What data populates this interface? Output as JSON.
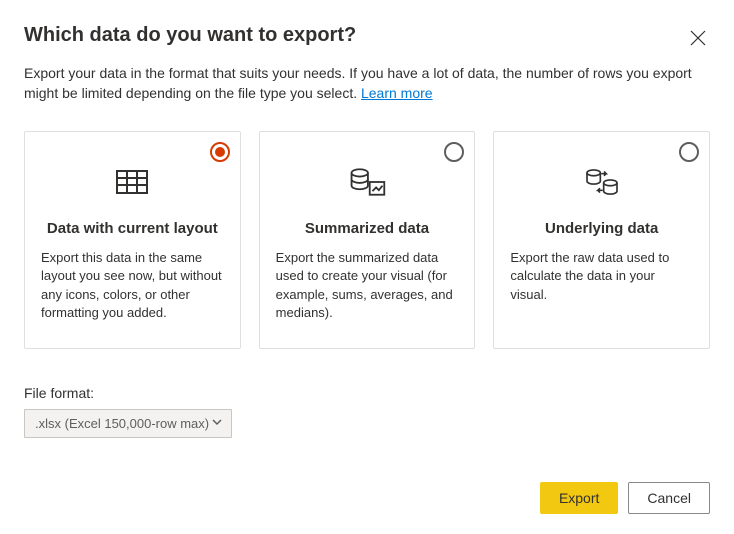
{
  "header": {
    "title": "Which data do you want to export?"
  },
  "description": {
    "text": "Export your data in the format that suits your needs. If you have a lot of data, the number of rows you export might be limited depending on the file type you select.  ",
    "learn_more": "Learn more"
  },
  "cards": [
    {
      "title": "Data with current layout",
      "desc": "Export this data in the same layout you see now, but without any icons, colors, or other formatting you added.",
      "selected": true
    },
    {
      "title": "Summarized data",
      "desc": "Export the summarized data used to create your visual (for example, sums, averages, and medians).",
      "selected": false
    },
    {
      "title": "Underlying data",
      "desc": "Export the raw data used to calculate the data in your visual.",
      "selected": false
    }
  ],
  "file_format": {
    "label": "File format:",
    "value": ".xlsx (Excel 150,000-row max)"
  },
  "footer": {
    "export": "Export",
    "cancel": "Cancel"
  }
}
